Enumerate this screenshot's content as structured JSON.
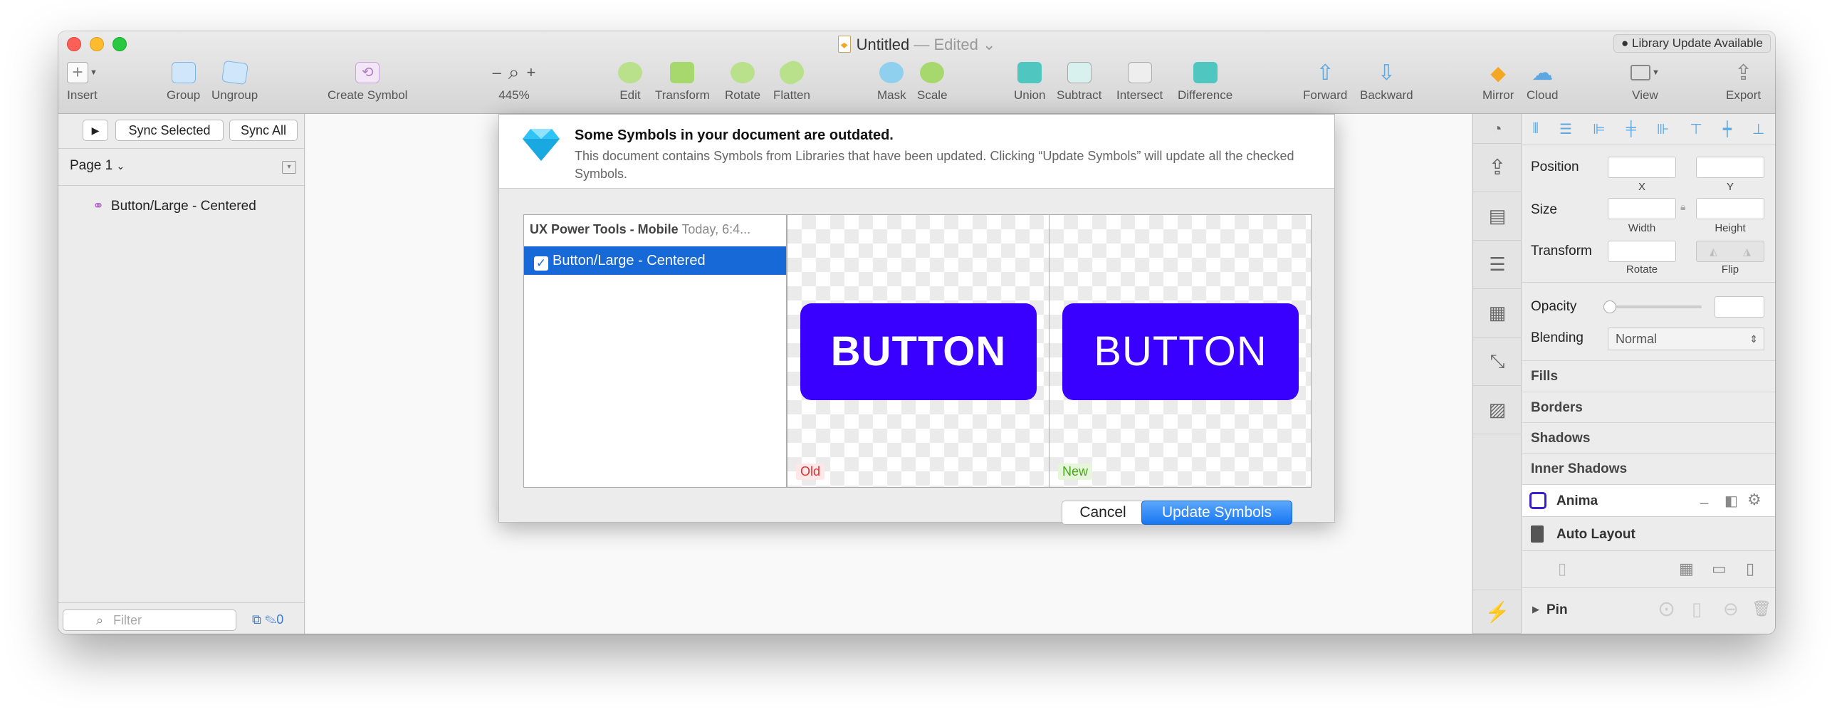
{
  "window": {
    "title": "Untitled",
    "edited_label": "— Edited",
    "library_badge": "Library Update Available"
  },
  "toolbar": {
    "insert": "Insert",
    "group": "Group",
    "ungroup": "Ungroup",
    "create_symbol": "Create Symbol",
    "zoom_level": "445%",
    "zoom_minus": "–",
    "zoom_plus": "+",
    "edit": "Edit",
    "transform": "Transform",
    "rotate": "Rotate",
    "flatten": "Flatten",
    "mask": "Mask",
    "scale": "Scale",
    "union": "Union",
    "subtract": "Subtract",
    "intersect": "Intersect",
    "difference": "Difference",
    "forward": "Forward",
    "backward": "Backward",
    "mirror": "Mirror",
    "cloud": "Cloud",
    "view": "View",
    "export": "Export"
  },
  "left_panel": {
    "sync_selected": "Sync Selected",
    "sync_all": "Sync All",
    "page": "Page 1",
    "layers": [
      {
        "name": "Button/Large - Centered"
      }
    ],
    "filter_placeholder": "Filter",
    "badge_count": "0"
  },
  "dialog": {
    "title": "Some Symbols in your document are outdated.",
    "description": "This document contains Symbols from Libraries that have been updated. Clicking “Update Symbols” will update all the checked Symbols.",
    "library_name": "UX Power Tools - Mobile",
    "library_date": "Today, 6:4...",
    "item": "Button/Large - Centered",
    "item_checked": true,
    "old_label": "Old",
    "new_label": "New",
    "preview_text": "BUTTON",
    "cancel": "Cancel",
    "update": "Update Symbols",
    "symbol_color": "#3a00ff"
  },
  "inspector": {
    "position": "Position",
    "x": "X",
    "y": "Y",
    "size": "Size",
    "width": "Width",
    "height": "Height",
    "transform": "Transform",
    "rotate": "Rotate",
    "flip": "Flip",
    "opacity": "Opacity",
    "blending": "Blending",
    "blending_value": "Normal",
    "fills": "Fills",
    "borders": "Borders",
    "shadows": "Shadows",
    "inner_shadows": "Inner Shadows",
    "anima": "Anima",
    "auto_layout": "Auto Layout",
    "pin": "Pin"
  }
}
